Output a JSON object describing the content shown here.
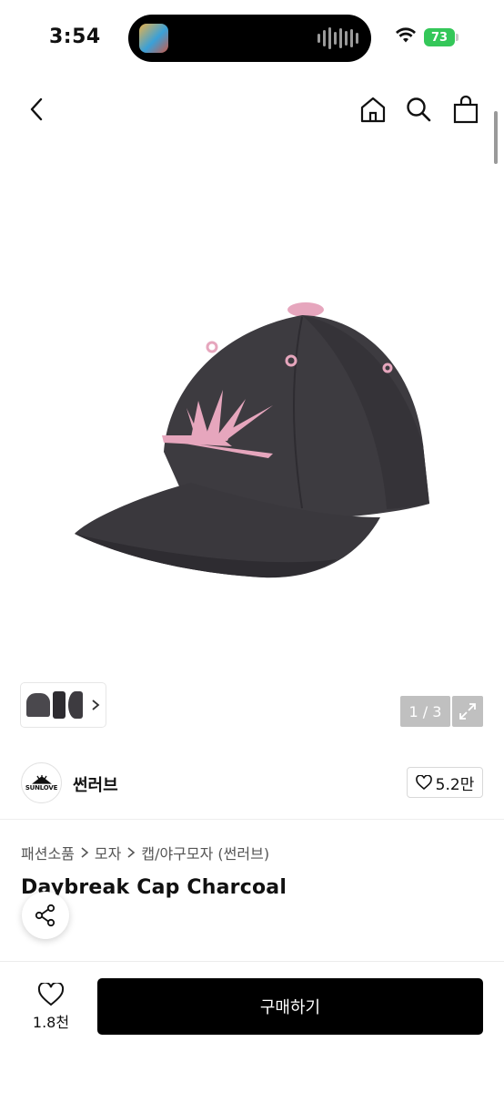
{
  "status_bar": {
    "time": "3:54",
    "battery": "73"
  },
  "header": {
    "back_icon": "chevron-left-icon",
    "home_icon": "home-icon",
    "search_icon": "search-icon",
    "bag_icon": "shopping-bag-icon"
  },
  "gallery": {
    "page_counter": "1 / 3",
    "expand_icon": "expand-icon",
    "thumbnails_icon": "chevron-right-icon"
  },
  "brand": {
    "logo_text": "SUNLOVE",
    "name": "썬러브",
    "likes": "5.2만"
  },
  "breadcrumb": [
    "패션소품",
    "모자",
    "캡/야구모자 (썬러브)"
  ],
  "product": {
    "title": "Daybreak Cap Charcoal"
  },
  "bottom_bar": {
    "wish_count": "1.8천",
    "buy_label": "구매하기"
  },
  "colors": {
    "cap": "#3d3b40",
    "accent_pink": "#e6a6bd",
    "teal": "#25b7c4",
    "battery_green": "#34c759"
  }
}
